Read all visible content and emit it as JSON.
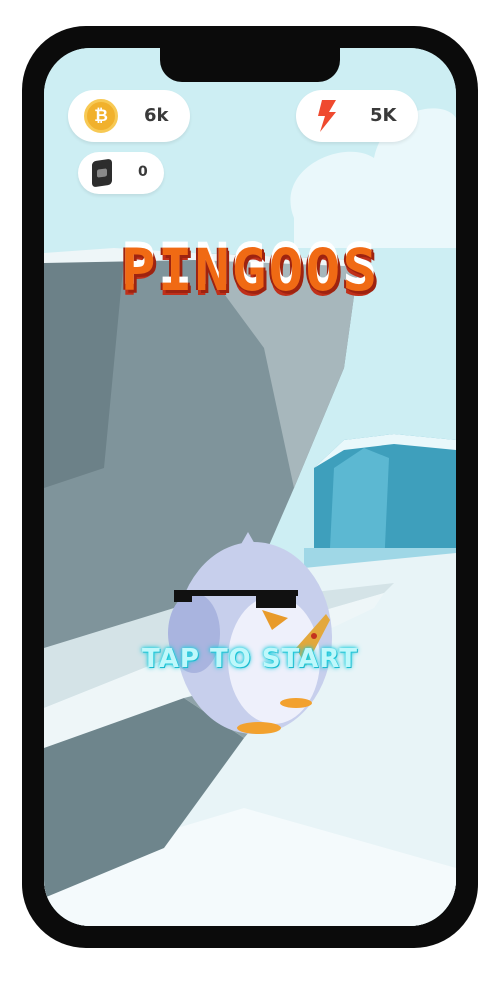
{
  "hud": {
    "coins": {
      "icon": "coin-icon",
      "symbol": "₿",
      "value": "6k"
    },
    "energy": {
      "icon": "lightning-icon",
      "value": "5K"
    },
    "gems": {
      "icon": "gem-icon",
      "value": "0"
    }
  },
  "game": {
    "title": "PINGOOS",
    "prompt": "TAP TO START"
  },
  "colors": {
    "title_orange": "#f06a14",
    "title_dark": "#9e2310",
    "coin_gold": "#f1b12c",
    "energy_red": "#ef4a2f",
    "prompt_cyan": "#1fd6e4"
  }
}
